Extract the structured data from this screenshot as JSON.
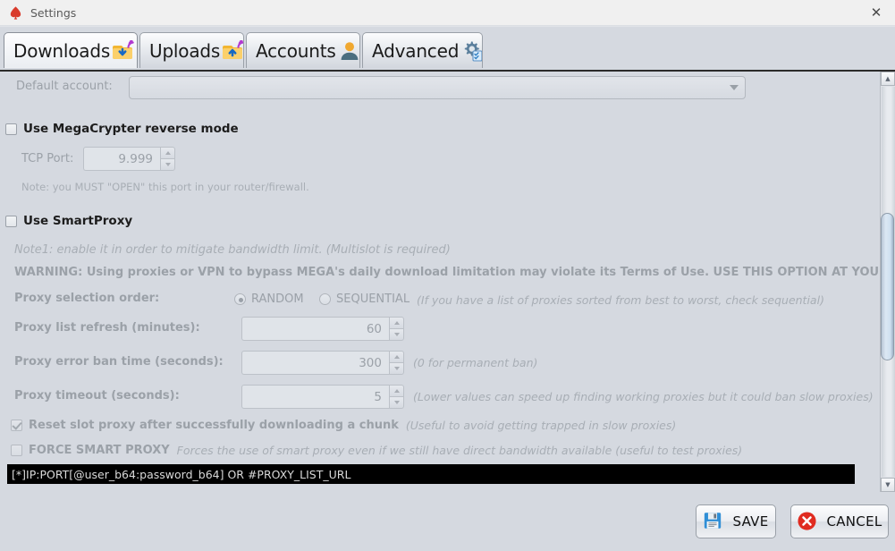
{
  "window": {
    "title": "Settings",
    "app_icon": "spade-icon",
    "close_label": "✕"
  },
  "tabs": [
    {
      "label": "Downloads",
      "icon": "folder-download-icon",
      "active": true
    },
    {
      "label": "Uploads",
      "icon": "folder-upload-icon",
      "active": false
    },
    {
      "label": "Accounts",
      "icon": "user-icon",
      "active": false
    },
    {
      "label": "Advanced",
      "icon": "gear-checklist-icon",
      "active": false
    }
  ],
  "form": {
    "default_account": {
      "label": "Default account:",
      "value": "",
      "placeholder": ""
    },
    "megacrypter": {
      "checkbox_label": "Use MegaCrypter reverse mode",
      "checked": false,
      "tcp_port_label": "TCP Port:",
      "tcp_port_value": "9.999",
      "note": "Note: you MUST \"OPEN\" this port in your router/firewall."
    },
    "smartproxy": {
      "checkbox_label": "Use SmartProxy",
      "checked": false,
      "note1": "Note1: enable it in order to mitigate bandwidth limit. (Multislot is required)",
      "warning": "WARNING: Using proxies or VPN to bypass MEGA's daily download limitation may violate its Terms of Use. USE THIS OPTION AT YOUR OWN RISK.",
      "selection_order_label": "Proxy selection order:",
      "option_random": "RANDOM",
      "option_sequential": "SEQUENTIAL",
      "selected_order": "RANDOM",
      "selection_hint": "(If you have a list of proxies sorted from best to worst, check sequential)",
      "refresh_label": "Proxy list refresh (minutes):",
      "refresh_value": "60",
      "ban_label": "Proxy error ban time (seconds):",
      "ban_value": "300",
      "ban_hint": "(0 for permanent ban)",
      "timeout_label": "Proxy timeout (seconds):",
      "timeout_value": "5",
      "timeout_hint": "(Lower values can speed up finding working proxies but it could ban slow proxies)",
      "reset_slot_label": "Reset slot proxy after successfully downloading a chunk",
      "reset_slot_checked": true,
      "reset_slot_hint": "(Useful to avoid getting trapped in slow proxies)",
      "force_label": "FORCE SMART PROXY",
      "force_checked": false,
      "force_hint": "Forces the use of smart proxy even if we still have direct bandwidth available (useful to test proxies)",
      "proxy_list_value": "[*]IP:PORT[@user_b64:password_b64] OR #PROXY_LIST_URL"
    }
  },
  "footer": {
    "save_label": "SAVE",
    "save_icon": "floppy-disk-icon",
    "cancel_label": "CANCEL",
    "cancel_icon": "red-x-circle-icon"
  },
  "scrollbar": {
    "up_arrow": "▲",
    "down_arrow": "▼"
  },
  "colors": {
    "background": "#d5d9e0",
    "disabled_text": "#9ba1a8",
    "enabled_text": "#1d1d1d",
    "terminal_bg": "#000000",
    "terminal_text": "#d9d9d9",
    "cancel_red": "#e02b20",
    "scrollbar_thumb": "#cfe0f0"
  }
}
